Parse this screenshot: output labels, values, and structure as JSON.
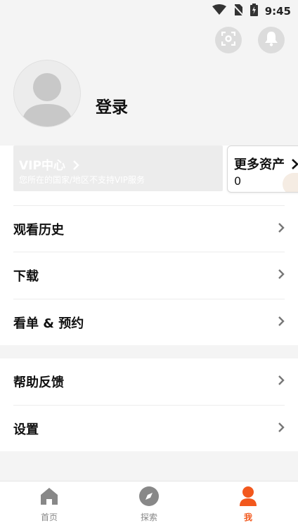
{
  "status_bar": {
    "time": "9:45",
    "icons": [
      "wifi-icon",
      "no-sim-icon",
      "battery-charging-icon"
    ]
  },
  "header": {
    "scan_icon": "scan-icon",
    "bell_icon": "bell-icon"
  },
  "profile": {
    "avatar_icon": "default-avatar-icon",
    "login_label": "登录"
  },
  "vip": {
    "title": "VIP中心",
    "subtitle": "您所在的国家/地区不支持VIP服务"
  },
  "assets": {
    "title": "更多资产",
    "value": "0"
  },
  "menu_group1": [
    {
      "label": "观看历史"
    },
    {
      "label": "下载"
    },
    {
      "label": "看单 & 预约"
    }
  ],
  "menu_group2": [
    {
      "label": "帮助反馈"
    },
    {
      "label": "设置"
    }
  ],
  "bottom_nav": [
    {
      "label": "首页",
      "icon": "home-icon",
      "active": false
    },
    {
      "label": "探索",
      "icon": "compass-icon",
      "active": false
    },
    {
      "label": "我",
      "icon": "profile-icon",
      "active": true
    }
  ],
  "colors": {
    "accent": "#f2581d",
    "inactive": "#888888",
    "background": "#f4f4f4"
  }
}
